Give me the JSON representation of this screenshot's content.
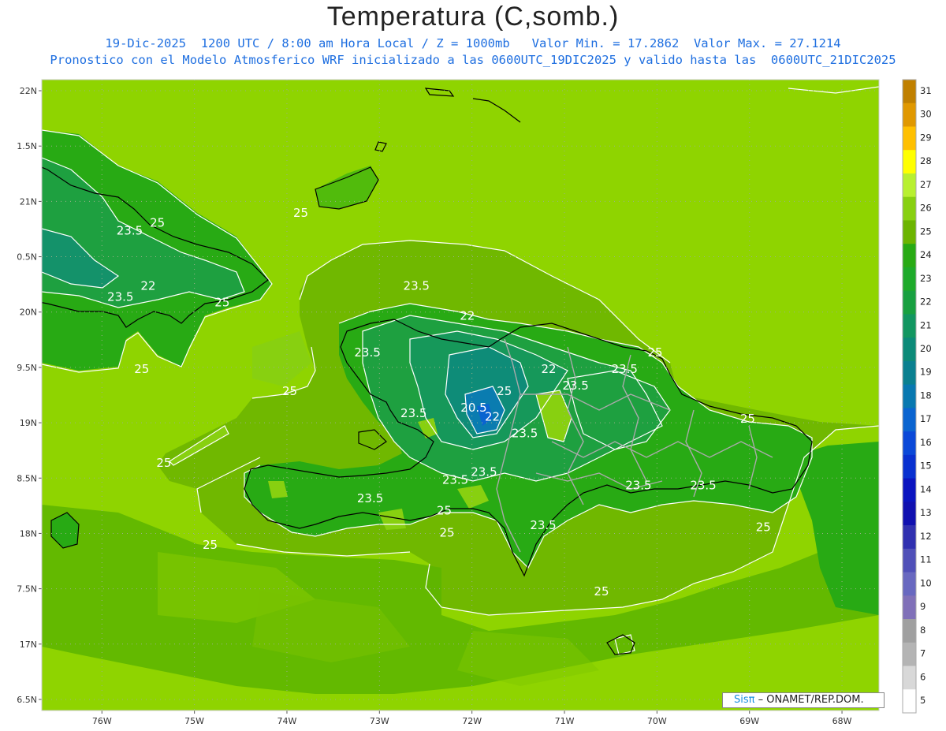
{
  "title": "Temperatura (C,somb.)",
  "subtitle_line1": "19-Dic-2025  1200 UTC / 8:00 am Hora Local / Z = 1000mb   Valor Min. = 17.2862  Valor Max. = 27.1214",
  "subtitle_line2": "Pronostico con el Modelo Atmosferico WRF inicializado a las 0600UTC_19DIC2025 y valido hasta las  0600UTC_21DIC2025",
  "credit": {
    "brand": "Sisπ",
    "text": "– ONAMET/REP.DOM."
  },
  "map": {
    "lon_min": -76.65,
    "lon_max": -67.6,
    "lat_min": 16.4,
    "lat_max": 22.1,
    "lon_ticks": [
      {
        "v": -76,
        "label": "76W"
      },
      {
        "v": -75,
        "label": "75W"
      },
      {
        "v": -74,
        "label": "74W"
      },
      {
        "v": -73,
        "label": "73W"
      },
      {
        "v": -72,
        "label": "72W"
      },
      {
        "v": -71,
        "label": "71W"
      },
      {
        "v": -70,
        "label": "70W"
      },
      {
        "v": -69,
        "label": "69W"
      },
      {
        "v": -68,
        "label": "68W"
      }
    ],
    "lat_ticks": [
      {
        "v": 22,
        "label": "22N"
      },
      {
        "v": 21.5,
        "label": "1.5N"
      },
      {
        "v": 21,
        "label": "21N"
      },
      {
        "v": 20.5,
        "label": "0.5N"
      },
      {
        "v": 20,
        "label": "20N"
      },
      {
        "v": 19.5,
        "label": "9.5N"
      },
      {
        "v": 19,
        "label": "19N"
      },
      {
        "v": 18.5,
        "label": "8.5N"
      },
      {
        "v": 18,
        "label": "18N"
      },
      {
        "v": 17.5,
        "label": "7.5N"
      },
      {
        "v": 17,
        "label": "17N"
      },
      {
        "v": 16.5,
        "label": "6.5N"
      }
    ]
  },
  "colorbar": {
    "levels": [
      "31",
      "30",
      "29",
      "28",
      "27",
      "26",
      "25",
      "24",
      "23",
      "22",
      "21",
      "20",
      "19",
      "18",
      "17",
      "16",
      "15",
      "14",
      "13",
      "12",
      "11",
      "10",
      "9",
      "8",
      "7",
      "6",
      "5"
    ],
    "colors": [
      "#c08000",
      "#e09800",
      "#ffc000",
      "#ffff00",
      "#b8f030",
      "#88d010",
      "#6cb400",
      "#28aa14",
      "#1eaa2a",
      "#18a040",
      "#129660",
      "#0c8a78",
      "#0a8090",
      "#0878b0",
      "#0a64d0",
      "#0a48d8",
      "#0830d0",
      "#0a14c0",
      "#1010b0",
      "#3030b0",
      "#5050b8",
      "#6868c0",
      "#8070b8",
      "#a0a0a0",
      "#b4b4b4",
      "#d8d8d8",
      "#ffffff"
    ]
  },
  "contour_labels": [
    {
      "text": "23.5",
      "lon": -75.7,
      "lat": 20.7
    },
    {
      "text": "25",
      "lon": -75.4,
      "lat": 20.77
    },
    {
      "text": "22",
      "lon": -75.5,
      "lat": 20.2
    },
    {
      "text": "23.5",
      "lon": -75.8,
      "lat": 20.1
    },
    {
      "text": "25",
      "lon": -74.7,
      "lat": 20.05
    },
    {
      "text": "25",
      "lon": -75.57,
      "lat": 19.45
    },
    {
      "text": "25",
      "lon": -73.85,
      "lat": 20.86
    },
    {
      "text": "23.5",
      "lon": -72.6,
      "lat": 20.2
    },
    {
      "text": "22",
      "lon": -72.05,
      "lat": 19.93
    },
    {
      "text": "23.5",
      "lon": -73.13,
      "lat": 19.6
    },
    {
      "text": "22",
      "lon": -71.17,
      "lat": 19.45
    },
    {
      "text": "23.5",
      "lon": -70.35,
      "lat": 19.45
    },
    {
      "text": "25",
      "lon": -70.02,
      "lat": 19.6
    },
    {
      "text": "23.5",
      "lon": -70.88,
      "lat": 19.3
    },
    {
      "text": "25",
      "lon": -71.65,
      "lat": 19.25
    },
    {
      "text": "20.5",
      "lon": -71.98,
      "lat": 19.1
    },
    {
      "text": "23.5",
      "lon": -72.63,
      "lat": 19.05
    },
    {
      "text": "22",
      "lon": -71.78,
      "lat": 19.02
    },
    {
      "text": "23.5",
      "lon": -71.43,
      "lat": 18.87
    },
    {
      "text": "25",
      "lon": -73.97,
      "lat": 19.25
    },
    {
      "text": "25",
      "lon": -69.02,
      "lat": 19.0
    },
    {
      "text": "25",
      "lon": -75.33,
      "lat": 18.6
    },
    {
      "text": "23.5",
      "lon": -72.18,
      "lat": 18.45
    },
    {
      "text": "23.5",
      "lon": -71.87,
      "lat": 18.52
    },
    {
      "text": "23.5",
      "lon": -73.1,
      "lat": 18.28
    },
    {
      "text": "25",
      "lon": -72.3,
      "lat": 18.17
    },
    {
      "text": "25",
      "lon": -72.27,
      "lat": 17.97
    },
    {
      "text": "23.5",
      "lon": -71.23,
      "lat": 18.04
    },
    {
      "text": "23.5",
      "lon": -70.2,
      "lat": 18.4
    },
    {
      "text": "23.5",
      "lon": -69.5,
      "lat": 18.4
    },
    {
      "text": "25",
      "lon": -68.85,
      "lat": 18.02
    },
    {
      "text": "25",
      "lon": -74.83,
      "lat": 17.86
    },
    {
      "text": "25",
      "lon": -70.6,
      "lat": 17.44
    }
  ]
}
